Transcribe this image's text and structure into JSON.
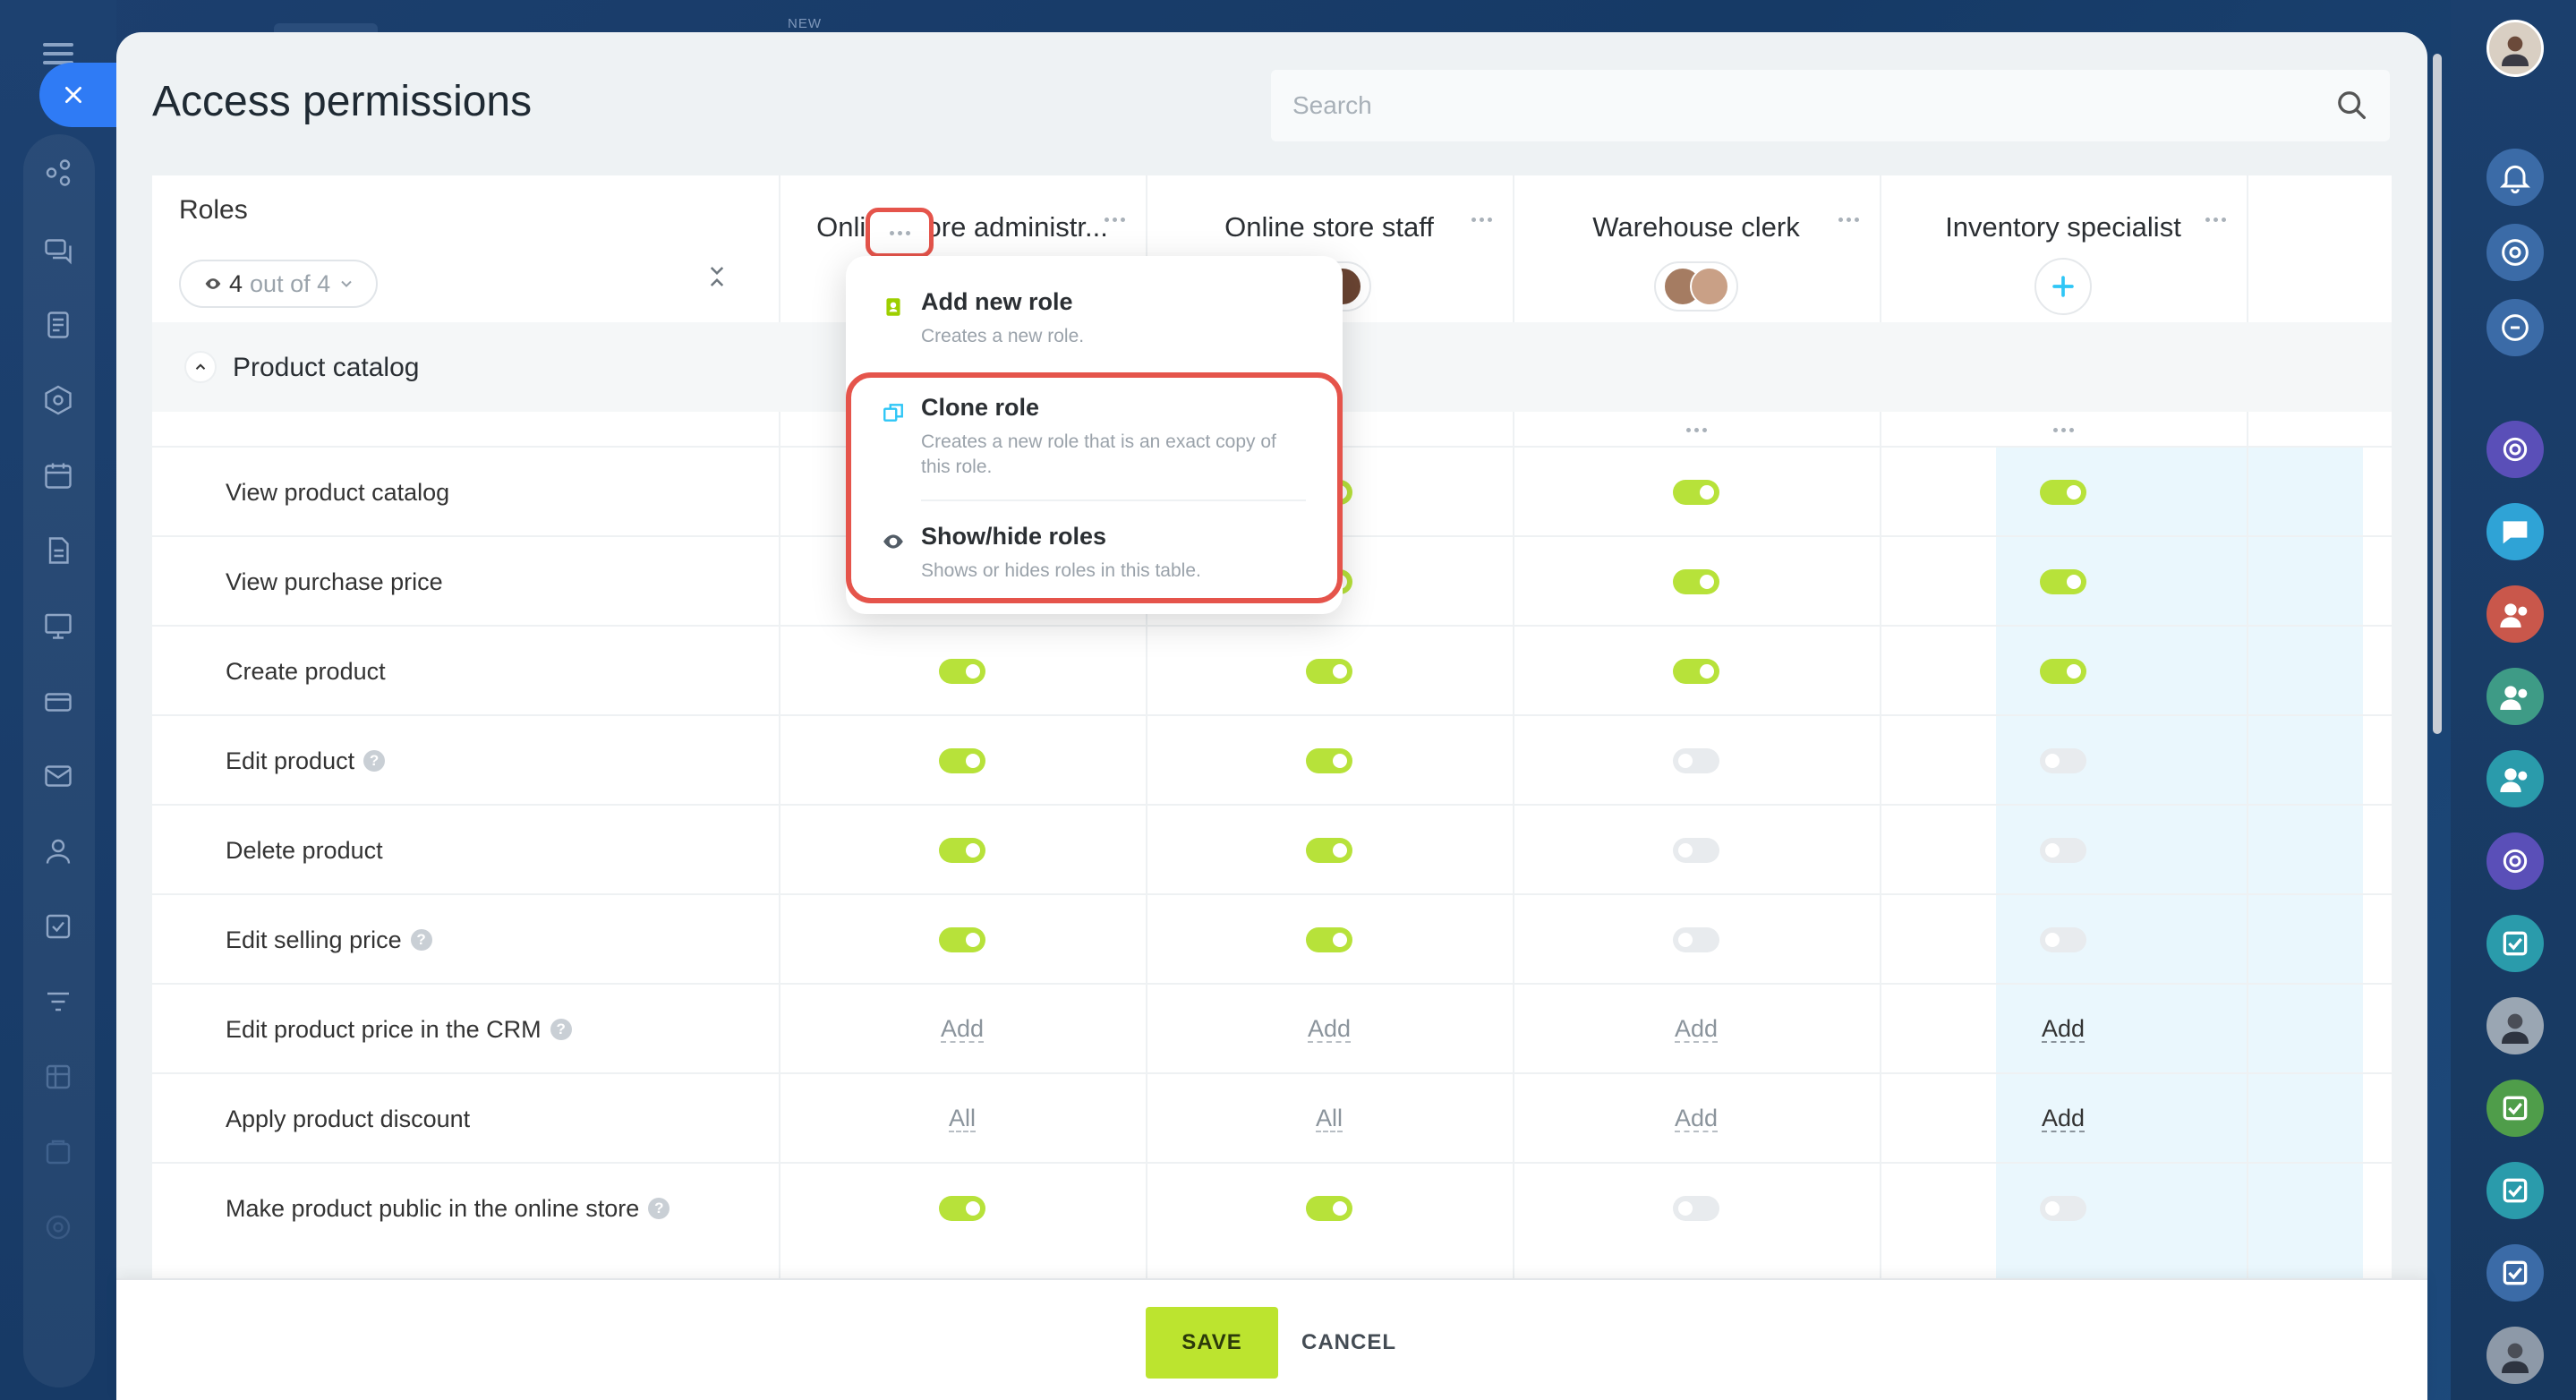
{
  "header": {
    "title": "Access permissions",
    "search_placeholder": "Search",
    "top_badge": "NEW"
  },
  "roles_panel": {
    "label": "Roles",
    "visible_count": "4",
    "visible_of": "out of 4"
  },
  "roles": [
    {
      "name": "Online store administr..."
    },
    {
      "name": "Online store staff"
    },
    {
      "name": "Warehouse clerk"
    },
    {
      "name": "Inventory specialist"
    }
  ],
  "section": {
    "title": "Product catalog"
  },
  "rows": [
    {
      "label": "View product catalog",
      "help": false,
      "cells": [
        "on",
        "on",
        "on",
        "on"
      ]
    },
    {
      "label": "View purchase price",
      "help": false,
      "cells": [
        "on",
        "on",
        "on",
        "on"
      ]
    },
    {
      "label": "Create product",
      "help": false,
      "cells": [
        "on",
        "on",
        "on",
        "on"
      ]
    },
    {
      "label": "Edit product",
      "help": true,
      "cells": [
        "on",
        "on",
        "off",
        "off"
      ]
    },
    {
      "label": "Delete product",
      "help": false,
      "cells": [
        "on",
        "on",
        "off",
        "off"
      ]
    },
    {
      "label": "Edit selling price",
      "help": true,
      "cells": [
        "on",
        "on",
        "off",
        "off"
      ]
    },
    {
      "label": "Edit product price in the CRM",
      "help": true,
      "cells": [
        "Add",
        "Add",
        "Add",
        "Add"
      ]
    },
    {
      "label": "Apply product discount",
      "help": false,
      "cells": [
        "All",
        "All",
        "Add",
        "Add"
      ]
    },
    {
      "label": "Make product public in the online store",
      "help": true,
      "cells": [
        "on",
        "on",
        "off",
        "off"
      ]
    }
  ],
  "popup": {
    "items": [
      {
        "title": "Add new role",
        "desc": "Creates a new role."
      },
      {
        "title": "Clone role",
        "desc": "Creates a new role that is an exact copy of this role."
      },
      {
        "title": "Show/hide roles",
        "desc": "Shows or hides roles in this table."
      }
    ]
  },
  "footer": {
    "save_label": "SAVE",
    "cancel_label": "CANCEL"
  },
  "colors": {
    "accent_green": "#bce42f",
    "toggle_on": "#b7e23a",
    "highlight_red": "#e5544b",
    "close_blue": "#2f7bf5"
  },
  "icons": [
    "menu-icon",
    "close-icon",
    "search-icon",
    "eye-icon",
    "chevron-down-icon",
    "collapse-icon",
    "more-dots-icon",
    "plus-icon",
    "chevron-up-icon",
    "help-icon",
    "add-role-icon",
    "clone-icon",
    "chevron-right-icon",
    "bell-icon"
  ]
}
